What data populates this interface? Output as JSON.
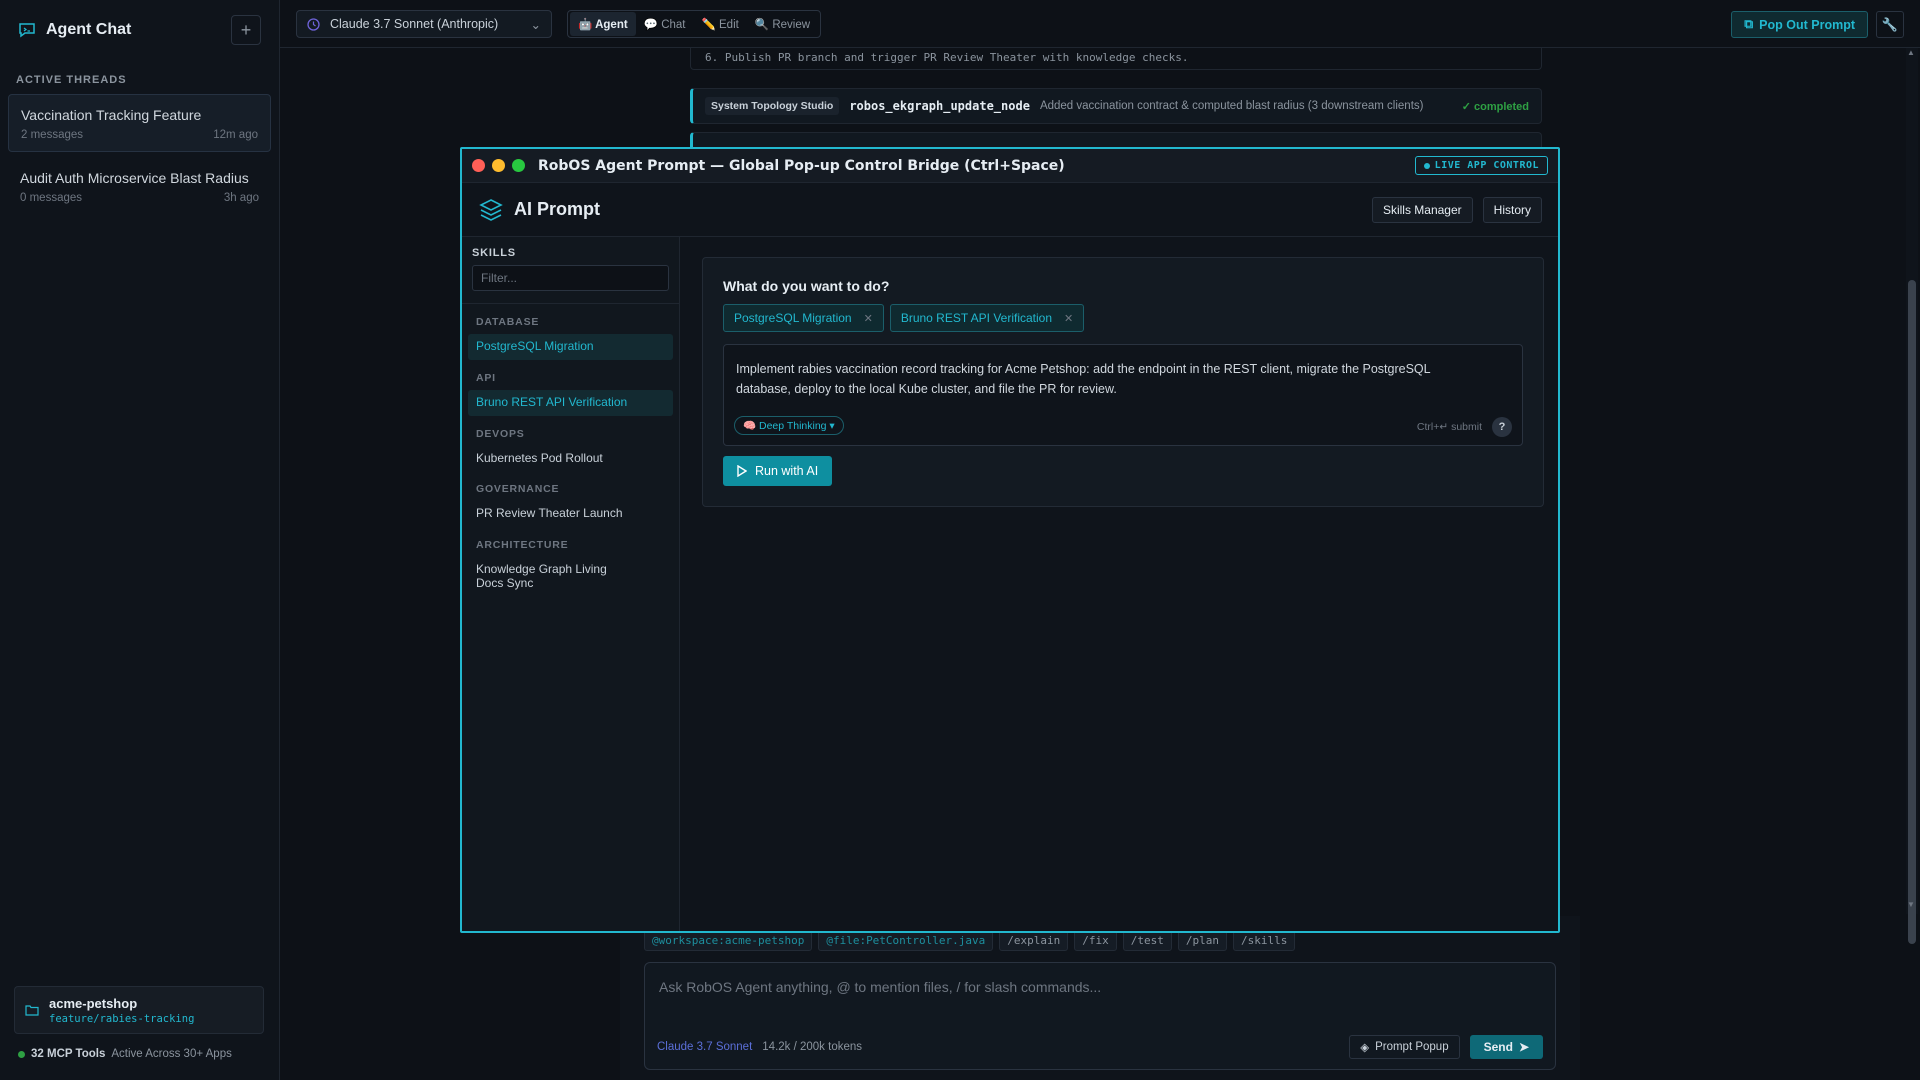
{
  "sidebar": {
    "title": "Agent Chat",
    "section": "ACTIVE THREADS",
    "threads": [
      {
        "title": "Vaccination Tracking Feature",
        "count": "2 messages",
        "time": "12m ago"
      },
      {
        "title": "Audit Auth Microservice Blast Radius",
        "count": "0 messages",
        "time": "3h ago"
      }
    ],
    "workspace": {
      "name": "acme-petshop",
      "branch": "feature/rabies-tracking"
    },
    "mcp": {
      "strong": "32 MCP Tools",
      "rest": "Active Across 30+ Apps"
    }
  },
  "topbar": {
    "model": "Claude 3.7 Sonnet (Anthropic)",
    "modes": [
      "Agent",
      "Chat",
      "Edit",
      "Review"
    ],
    "popout": "Pop Out Prompt"
  },
  "feed": {
    "step6": "6. Publish PR branch and trigger PR Review Theater with knowledge checks.",
    "tool": {
      "source": "System Topology Studio",
      "name": "robos_ekgraph_update_node",
      "desc": "Added vaccination contract & computed blast radius (3 downstream clients)",
      "status": "✓ completed"
    }
  },
  "composer": {
    "chips": [
      "@workspace:acme-petshop",
      "@file:PetController.java",
      "/explain",
      "/fix",
      "/test",
      "/plan",
      "/skills"
    ],
    "placeholder": "Ask RobOS Agent anything, @ to mention files, / for slash commands...",
    "model": "Claude 3.7 Sonnet",
    "tokens": "14.2k / 200k tokens",
    "popup": "Prompt Popup",
    "send": "Send"
  },
  "modal": {
    "title": "RobOS Agent Prompt — Global Pop-up Control Bridge (Ctrl+Space)",
    "live": "LIVE APP CONTROL",
    "header": "AI Prompt",
    "skills_manager": "Skills Manager",
    "history": "History",
    "skills_label": "SKILLS",
    "filter_placeholder": "Filter...",
    "categories": [
      {
        "name": "DATABASE",
        "item": "PostgreSQL Migration"
      },
      {
        "name": "API",
        "item": "Bruno REST API Verification"
      },
      {
        "name": "DEVOPS",
        "item": "Kubernetes Pod Rollout"
      },
      {
        "name": "GOVERNANCE",
        "item": "PR Review Theater Launch"
      },
      {
        "name": "ARCHITECTURE",
        "item": "Knowledge Graph Living Docs Sync"
      }
    ],
    "question": "What do you want to do?",
    "tags": [
      "PostgreSQL Migration",
      "Bruno REST API Verification"
    ],
    "prompt": "Implement rabies vaccination record tracking for Acme Petshop: add the endpoint in the REST client, migrate the PostgreSQL database, deploy to the local Kube cluster, and file the PR for review.",
    "deep": "🧠 Deep Thinking ▾",
    "hint": "Ctrl+↵ submit",
    "help": "?",
    "run": "Run with AI"
  },
  "colors": {
    "accent": "#22b8cf",
    "success": "#2ea043"
  }
}
